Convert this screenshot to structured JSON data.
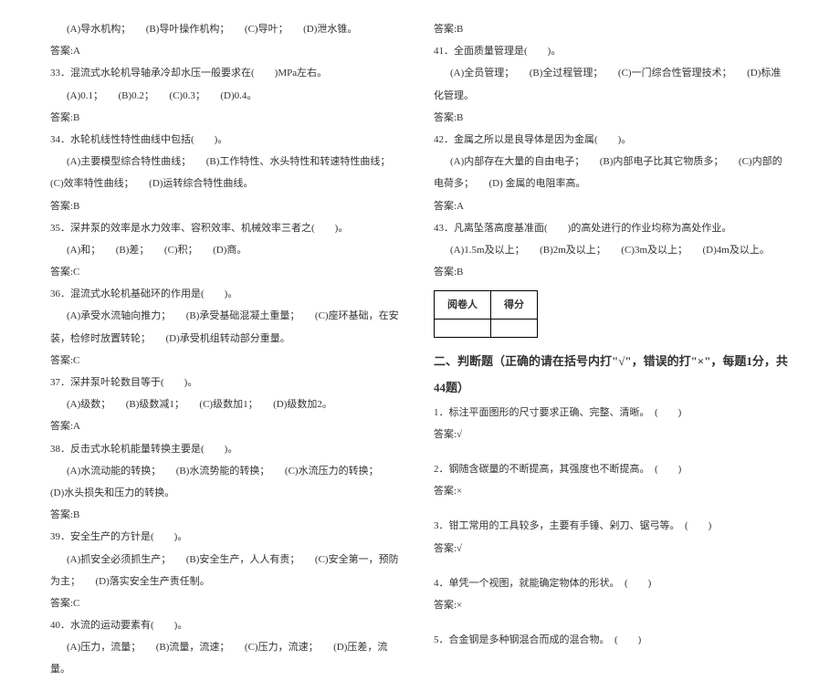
{
  "leftColumn": {
    "q32_options": "(A)导水机构；　　(B)导叶操作机构；　　(C)导叶；　　(D)泄水锥。",
    "a32": "答案:A",
    "q33": "33．混流式水轮机导轴承冷却水压一般要求在(　　)MPa左右。",
    "q33_options": "(A)0.1；　　(B)0.2；　　(C)0.3；　　(D)0.4。",
    "a33": "答案:B",
    "q34": "34．水轮机线性特性曲线中包括(　　)。",
    "q34_options": "(A)主要模型综合特性曲线；　　(B)工作特性、水头特性和转速特性曲线；　　(C)效率特性曲线；　　(D)运转综合特性曲线。",
    "a34": "答案:B",
    "q35": "35．深井泵的效率是水力效率、容积效率、机械效率三者之(　　)。",
    "q35_options": "(A)和；　　(B)差；　　(C)积；　　(D)商。",
    "a35": "答案:C",
    "q36": "36．混流式水轮机基础环的作用是(　　)。",
    "q36_options": "(A)承受水流轴向推力；　　(B)承受基础混凝土重量；　　(C)座环基础，在安装，检修时放置转轮；　　(D)承受机组转动部分重量。",
    "a36": "答案:C",
    "q37": "37．深井泵叶轮数目等于(　　)。",
    "q37_options": "(A)级数；　　(B)级数减1；　　(C)级数加1；　　(D)级数加2。",
    "a37": "答案:A",
    "q38": "38．反击式水轮机能量转换主要是(　　)。",
    "q38_options": "(A)水流动能的转换；　　(B)水流势能的转换；　　(C)水流压力的转换；　　(D)水头损失和压力的转换。",
    "a38": "答案:B",
    "q39": "39．安全生产的方针是(　　)。",
    "q39_options": "(A)抓安全必须抓生产；　　(B)安全生产，人人有责；　　(C)安全第一，预防为主；　　(D)落实安全生产责任制。",
    "a39": "答案:C",
    "q40": "40．水流的运动要素有(　　)。",
    "q40_options": "(A)压力，流量；　　(B)流量，流速；　　(C)压力，流速；　　(D)压差，流量。"
  },
  "rightColumn": {
    "a40": "答案:B",
    "q41": "41．全面质量管理是(　　)。",
    "q41_options": "(A)全员管理；　　(B)全过程管理；　　(C)一门综合性管理技术；　　(D)标准化管理。",
    "a41": "答案:B",
    "q42": "42．金属之所以是良导体是因为金属(　　)。",
    "q42_options": "(A)内部存在大量的自由电子；　　(B)内部电子比其它物质多；　　(C)内部的电荷多；　　(D) 金属的电阻率高。",
    "a42": "答案:A",
    "q43": "43．凡离坠落高度基准面(　　)的高处进行的作业均称为高处作业。",
    "q43_options": "(A)1.5m及以上；　　(B)2m及以上；　　(C)3m及以上；　　(D)4m及以上。",
    "a43": "答案:B",
    "scoreTable": {
      "header1": "阅卷人",
      "header2": "得分"
    },
    "section2Title": "二、判断题（正确的请在括号内打\"√\"，错误的打\"×\"，每题1分，共44题）",
    "tf1": "1．标注平面图形的尺寸要求正确、完整、清晰。　(　　)",
    "tf1_ans": "答案:√",
    "tf2": "2．钢随含碳量的不断提高，其强度也不断提高。　(　　)",
    "tf2_ans": "答案:×",
    "tf3": "3．钳工常用的工具较多，主要有手锤、剁刀、锯弓等。　(　　)",
    "tf3_ans": "答案:√",
    "tf4": "4．单凭一个视图，就能确定物体的形状。　(　　)",
    "tf4_ans": "答案:×",
    "tf5": "5．合金钢是多种钢混合而成的混合物。　(　　)"
  }
}
